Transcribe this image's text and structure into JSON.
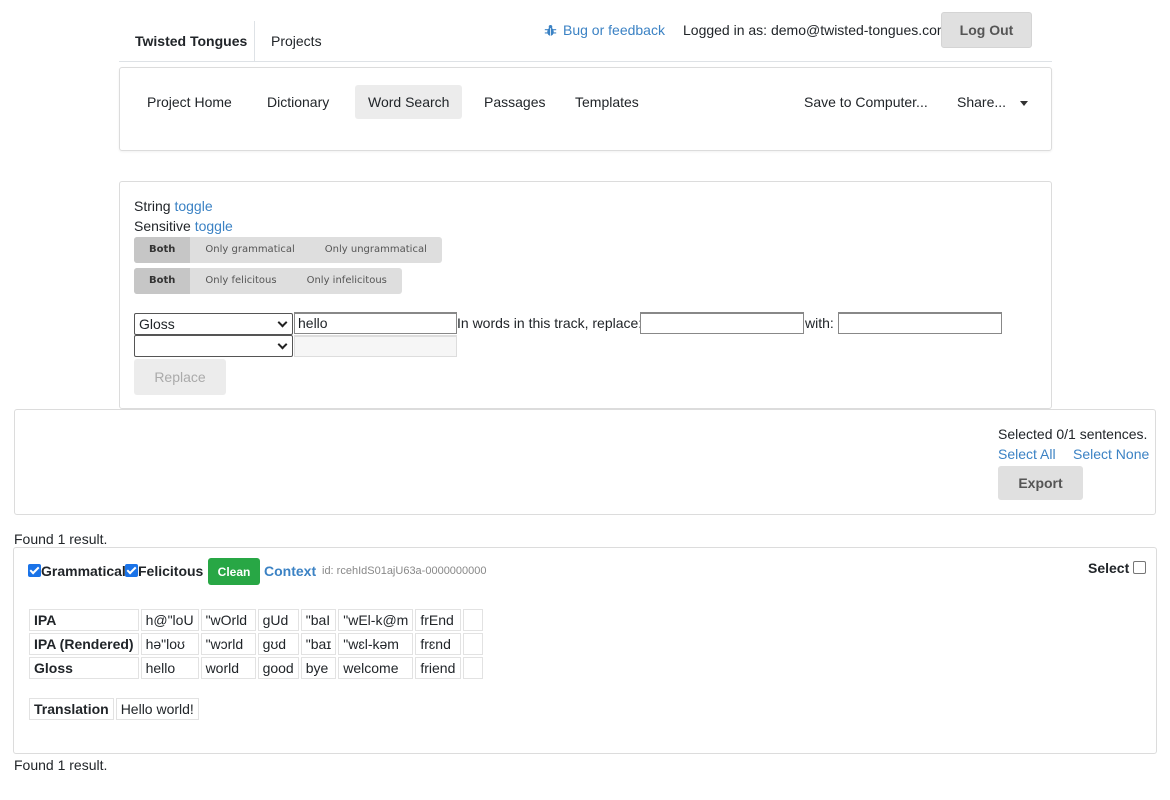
{
  "header": {
    "brand": "Twisted Tongues",
    "projects": "Projects",
    "bug_feedback": "Bug or feedback",
    "logged_in": "Logged in as: demo@twisted-tongues.com",
    "logout": "Log Out"
  },
  "nav": {
    "tabs": [
      "Project Home",
      "Dictionary",
      "Word Search",
      "Passages",
      "Templates"
    ],
    "active_tab": "Word Search",
    "save": "Save to Computer...",
    "share": "Share..."
  },
  "search": {
    "string_label": "String",
    "sensitive_label": "Sensitive",
    "toggle": "toggle",
    "grammatical_options": [
      "Both",
      "Only grammatical",
      "Only ungrammatical"
    ],
    "felicitous_options": [
      "Both",
      "Only felicitous",
      "Only infelicitous"
    ],
    "field_select": "Gloss",
    "field_value": "hello",
    "second_select": "",
    "replace_label": "In words in this track, replace:",
    "with_label": "with:",
    "replace_value": "",
    "with_value": "",
    "replace_button": "Replace"
  },
  "selection": {
    "status": "Selected 0/1 sentences.",
    "select_all": "Select All",
    "select_none": "Select None",
    "export": "Export"
  },
  "results": {
    "found_text": "Found 1 result.",
    "sentence": {
      "grammatical_label": "Grammatical",
      "grammatical": true,
      "felicitous_label": "Felicitous",
      "felicitous": true,
      "clean_label": "Clean",
      "context_label": "Context",
      "id_text": "id: rcehIdS01ajU63a-0000000000",
      "select_label": "Select",
      "rows": [
        {
          "label": "IPA",
          "cells": [
            "h@\"loU",
            "\"wOrld",
            "gUd",
            "\"baI",
            "\"wEl-k@m",
            "frEnd",
            ""
          ]
        },
        {
          "label": "IPA (Rendered)",
          "cells": [
            "hə\"loʊ",
            "\"wɔrld",
            "gʊd",
            "\"baɪ",
            "\"wɛl-kəm",
            "frɛnd",
            ""
          ]
        },
        {
          "label": "Gloss",
          "cells": [
            "hello",
            "world",
            "good",
            "bye",
            "welcome",
            "friend",
            ""
          ]
        }
      ],
      "translation_label": "Translation",
      "translation": "Hello world!"
    }
  },
  "colors": {
    "link": "#3b82c4",
    "clean_button": "#28a745",
    "checkbox": "#1a73e8"
  }
}
